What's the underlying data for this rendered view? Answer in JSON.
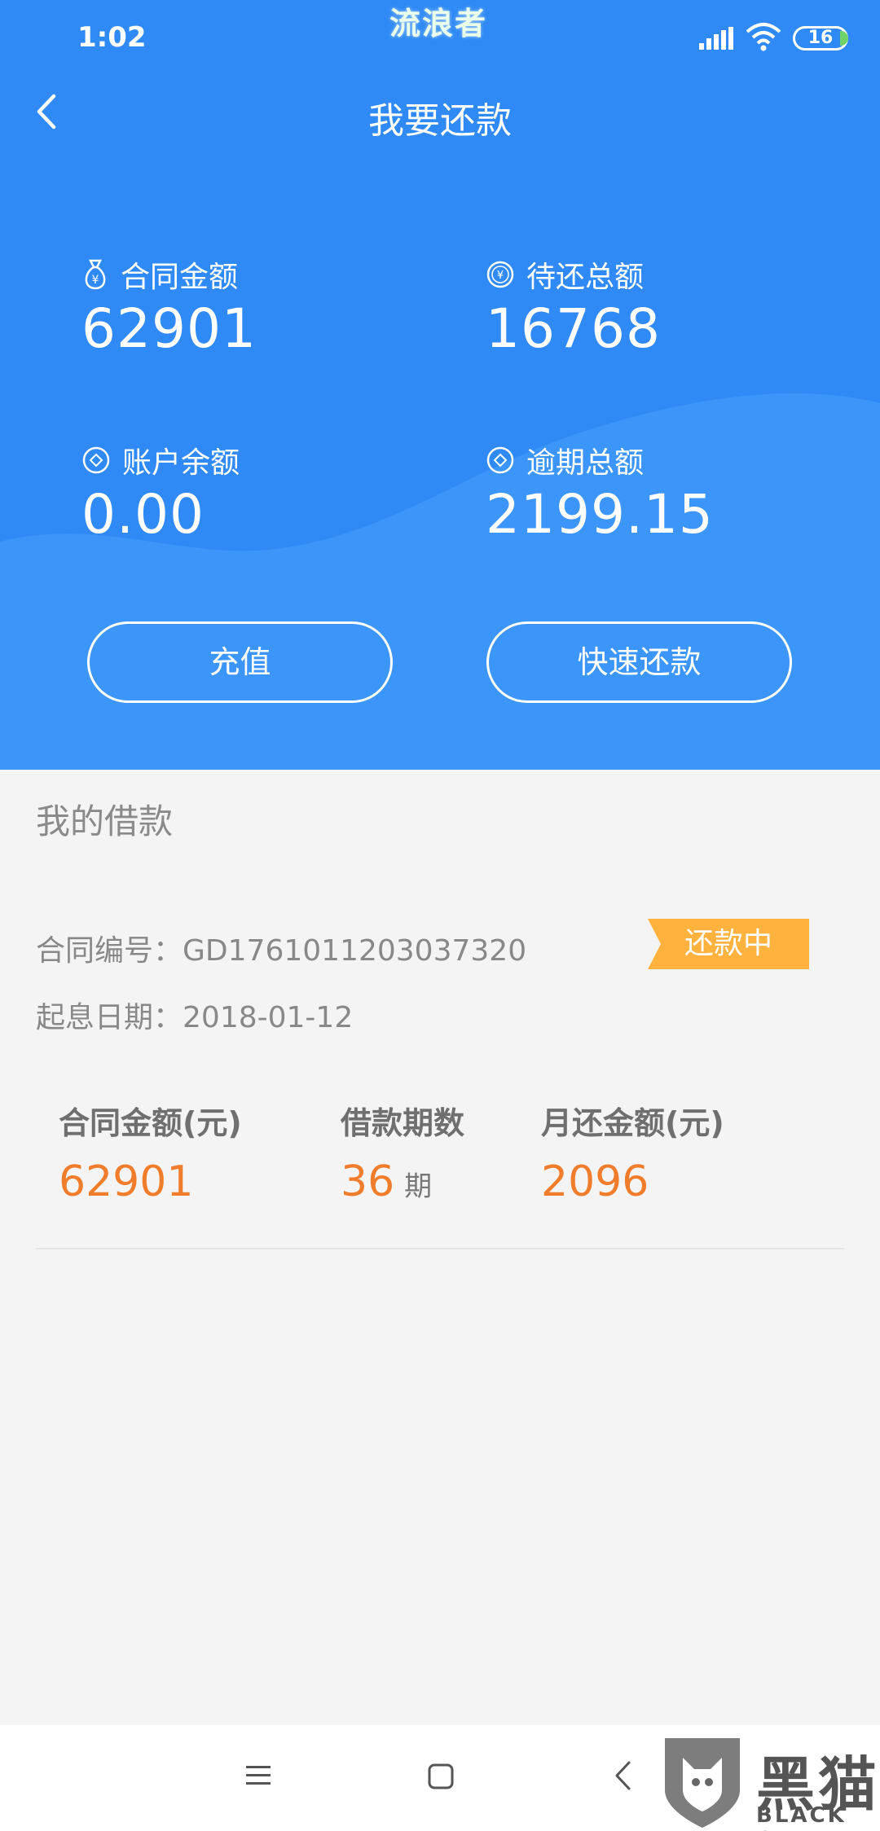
{
  "status_bar": {
    "time": "1:02",
    "watermark": "流浪者",
    "battery": "16"
  },
  "header": {
    "title": "我要还款"
  },
  "summary": {
    "contract_amount": {
      "label": "合同金额",
      "value": "62901",
      "icon": "money-bag-icon"
    },
    "pending_total": {
      "label": "待还总额",
      "value": "16768",
      "icon": "yen-coin-icon"
    },
    "account_balance": {
      "label": "账户余额",
      "value": "0.00",
      "icon": "coin-icon"
    },
    "overdue_total": {
      "label": "逾期总额",
      "value": "2199.15",
      "icon": "coin-icon"
    },
    "recharge_label": "充值",
    "quick_repay_label": "快速还款"
  },
  "loans": {
    "section_title": "我的借款",
    "contract_no_label": "合同编号：",
    "contract_no": "GD1761011203037320",
    "start_date_label": "起息日期：",
    "start_date": "2018-01-12",
    "status_badge": "还款中",
    "columns": [
      {
        "label": "合同金额(元)",
        "value": "62901",
        "unit": ""
      },
      {
        "label": "借款期数",
        "value": "36",
        "unit": "期"
      },
      {
        "label": "月还金额(元)",
        "value": "2096",
        "unit": ""
      }
    ]
  },
  "brand_watermark": {
    "cn": "黑猫",
    "en": "BLACK CAT"
  },
  "colors": {
    "primary_blue": "#2f8af5",
    "accent_orange": "#f07d2c",
    "badge_orange": "#ffb23e"
  }
}
